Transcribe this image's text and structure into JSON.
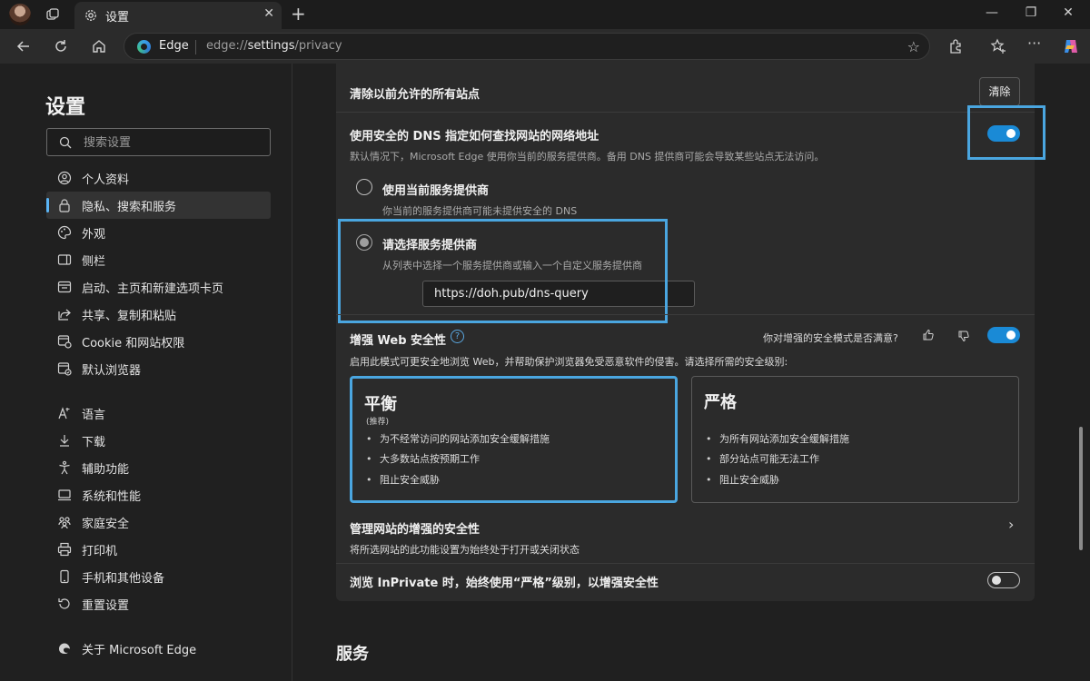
{
  "tab": {
    "title": "设置"
  },
  "address": {
    "site": "Edge",
    "url_prefix": "edge://",
    "url_path": "settings",
    "url_suffix": "/privacy"
  },
  "sidebar": {
    "title": "设置",
    "search_placeholder": "搜索设置",
    "items": [
      {
        "label": "个人资料",
        "icon": "profile-icon"
      },
      {
        "label": "隐私、搜索和服务",
        "icon": "lock-icon",
        "active": true
      },
      {
        "label": "外观",
        "icon": "appearance-icon"
      },
      {
        "label": "侧栏",
        "icon": "sidebar-icon"
      },
      {
        "label": "启动、主页和新建选项卡页",
        "icon": "startup-icon"
      },
      {
        "label": "共享、复制和粘贴",
        "icon": "share-icon"
      },
      {
        "label": "Cookie 和网站权限",
        "icon": "cookie-icon"
      },
      {
        "label": "默认浏览器",
        "icon": "browser-icon"
      },
      {
        "label": "语言",
        "icon": "language-icon"
      },
      {
        "label": "下载",
        "icon": "download-icon"
      },
      {
        "label": "辅助功能",
        "icon": "accessibility-icon"
      },
      {
        "label": "系统和性能",
        "icon": "system-icon"
      },
      {
        "label": "家庭安全",
        "icon": "family-icon"
      },
      {
        "label": "打印机",
        "icon": "printer-icon"
      },
      {
        "label": "手机和其他设备",
        "icon": "phone-icon"
      },
      {
        "label": "重置设置",
        "icon": "reset-icon"
      },
      {
        "label": "关于 Microsoft Edge",
        "icon": "edge-icon"
      }
    ]
  },
  "clear_sites": {
    "title": "清除以前允许的所有站点",
    "button": "清除"
  },
  "dns": {
    "title": "使用安全的 DNS 指定如何查找网站的网络地址",
    "desc": "默认情况下，Microsoft Edge 使用你当前的服务提供商。备用 DNS 提供商可能会导致某些站点无法访问。",
    "enabled": true,
    "option_current": {
      "title": "使用当前服务提供商",
      "desc": "你当前的服务提供商可能未提供安全的 DNS"
    },
    "option_choose": {
      "title": "请选择服务提供商",
      "desc": "从列表中选择一个服务提供商或输入一个自定义服务提供商",
      "value": "https://doh.pub/dns-query"
    }
  },
  "web_security": {
    "title": "增强 Web 安全性",
    "feedback": "你对增强的安全模式是否满意?",
    "enabled": true,
    "desc": "启用此模式可更安全地浏览 Web，并帮助保护浏览器免受恶意软件的侵害。请选择所需的安全级别:",
    "balanced": {
      "name": "平衡",
      "sub": "(推荐)",
      "bullets": [
        "为不经常访问的网站添加安全缓解措施",
        "大多数站点按预期工作",
        "阻止安全威胁"
      ]
    },
    "strict": {
      "name": "严格",
      "bullets": [
        "为所有网站添加安全缓解措施",
        "部分站点可能无法工作",
        "阻止安全威胁"
      ]
    }
  },
  "manage": {
    "title": "管理网站的增强的安全性",
    "desc": "将所选网站的此功能设置为始终处于打开或关闭状态"
  },
  "inprivate": {
    "title": "浏览 InPrivate 时，始终使用“严格”级别，以增强安全性",
    "enabled": false
  },
  "services": {
    "title": "服务"
  },
  "colors": {
    "accent": "#1a8ad6",
    "highlight": "#4aa6e0"
  }
}
